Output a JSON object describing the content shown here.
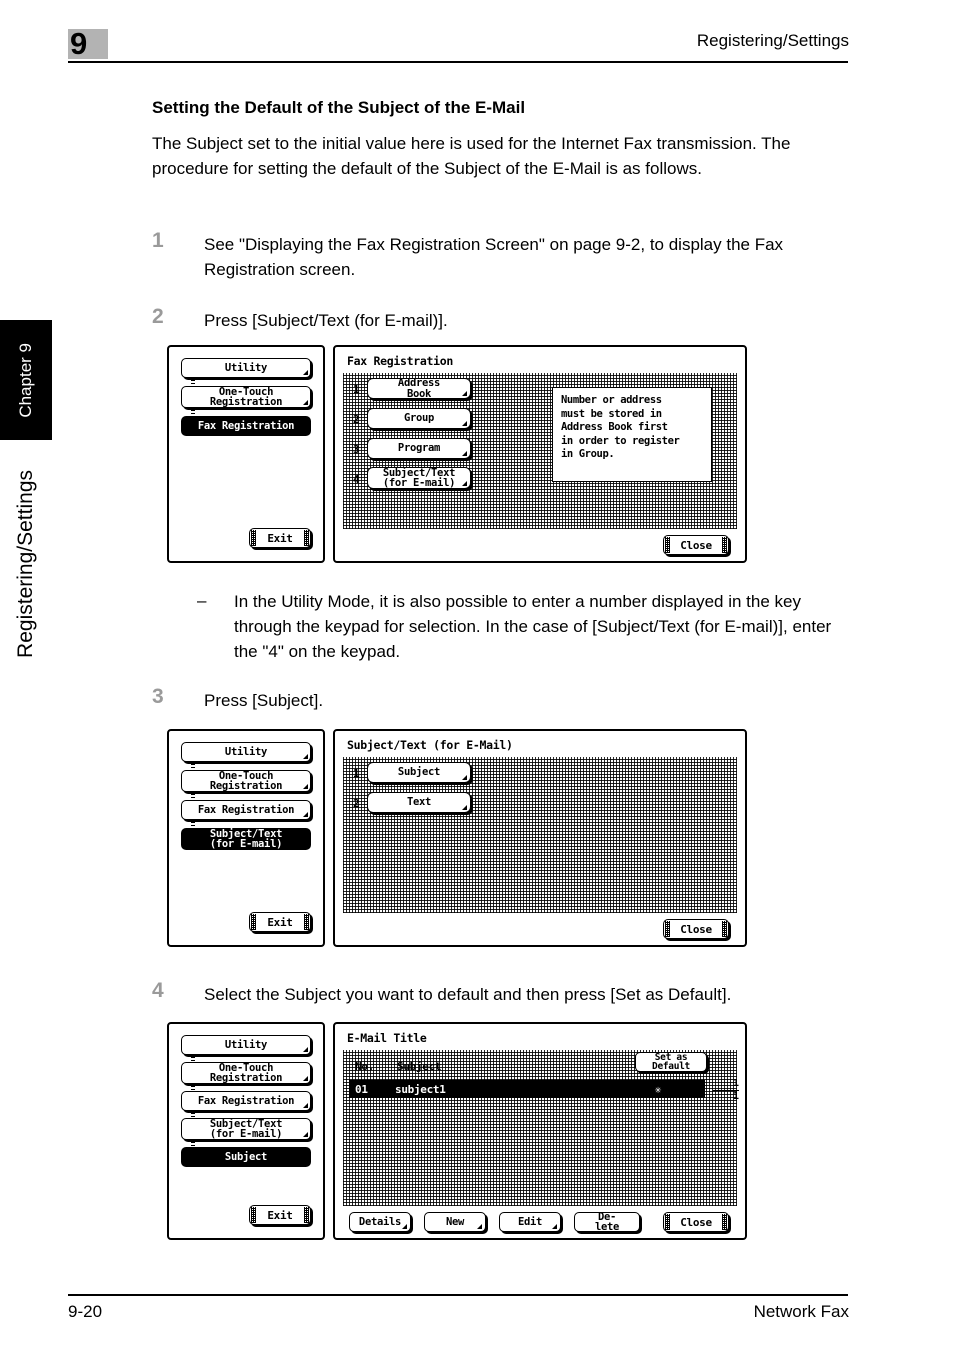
{
  "header": {
    "chapter_number": "9",
    "title": "Registering/Settings"
  },
  "side_tab": {
    "chapter_label": "Chapter 9",
    "section_label": "Registering/Settings"
  },
  "footer": {
    "page_number": "9-20",
    "doc_title": "Network Fax"
  },
  "section": {
    "heading": "Setting the Default of the Subject of the E-Mail",
    "intro": "The Subject set to the initial value here is used for the Internet Fax transmission. The procedure for setting the default of the Subject of the E-Mail is as follows."
  },
  "steps": [
    {
      "num": "1",
      "text": "See \"Displaying the Fax Registration Screen\" on page 9-2, to display the Fax Registration screen."
    },
    {
      "num": "2",
      "text": "Press [Subject/Text (for E-mail)]."
    },
    {
      "num": "3",
      "text": "Press [Subject]."
    },
    {
      "num": "4",
      "text": "Select the Subject you want to default and then press [Set as Default]."
    }
  ],
  "note": {
    "dash": "–",
    "text": "In the Utility Mode, it is also possible to enter a number displayed in the key through the keypad for selection. In the case of [Subject/Text (for E-mail)], enter the \"4\" on the keypad."
  },
  "screens": {
    "fax_registration": {
      "sidebar": [
        {
          "label": "Utility",
          "selected": false
        },
        {
          "label": "One-Touch\nRegistration",
          "selected": false
        },
        {
          "label": "Fax Registration",
          "selected": true
        }
      ],
      "exit_label": "Exit",
      "title": "Fax Registration",
      "items": [
        {
          "no": "1",
          "label": "Address\nBook"
        },
        {
          "no": "2",
          "label": "Group"
        },
        {
          "no": "3",
          "label": "Program"
        },
        {
          "no": "4",
          "label": "Subject/Text\n(for E-mail)"
        }
      ],
      "info_text": "Number or address\nmust be stored in\nAddress Book first\nin order to register\nin Group.",
      "close_label": "Close"
    },
    "subject_text": {
      "sidebar": [
        {
          "label": "Utility",
          "selected": false
        },
        {
          "label": "One-Touch\nRegistration",
          "selected": false
        },
        {
          "label": "Fax Registration",
          "selected": false
        },
        {
          "label": "Subject/Text\n(for E-mail)",
          "selected": true
        }
      ],
      "exit_label": "Exit",
      "title": "Subject/Text (for E-Mail)",
      "items": [
        {
          "no": "1",
          "label": "Subject"
        },
        {
          "no": "2",
          "label": "Text"
        }
      ],
      "close_label": "Close"
    },
    "email_title": {
      "sidebar": [
        {
          "label": "Utility",
          "selected": false
        },
        {
          "label": "One-Touch\nRegistration",
          "selected": false
        },
        {
          "label": "Fax Registration",
          "selected": false
        },
        {
          "label": "Subject/Text\n(for E-mail)",
          "selected": false
        },
        {
          "label": "Subject",
          "selected": true
        }
      ],
      "exit_label": "Exit",
      "title": "E-Mail Title",
      "col_no": "No.",
      "col_subject": "Subject",
      "set_as_default_label": "Set as\nDefault",
      "rows": [
        {
          "no": "01",
          "subject": "subject1",
          "mark": "✳"
        }
      ],
      "pager_current": "1",
      "pager_total": "1",
      "buttons": [
        {
          "label": "Details"
        },
        {
          "label": "New"
        },
        {
          "label": "Edit"
        },
        {
          "label": "De-\nlete"
        }
      ],
      "close_label": "Close"
    }
  }
}
